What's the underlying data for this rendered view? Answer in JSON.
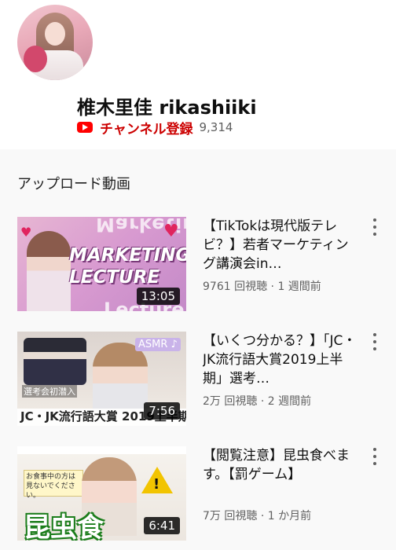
{
  "channel": {
    "name": "椎木里佳 rikashiiki",
    "subscribe_label": "チャンネル登録",
    "subscriber_count": "9,314"
  },
  "uploads": {
    "title": "アップロード動画",
    "videos": [
      {
        "title": "【TikTokは現代版テレビ？】若者マーケティング講演会in…",
        "views": "9761 回視聴",
        "age": "1 週間前",
        "duration": "13:05",
        "thumb_text": [
          "MARKETING",
          "LECTURE",
          "Marketing",
          "Lecture"
        ]
      },
      {
        "title": "【いくつ分かる？】「JC・JK流行語大賞2019上半期」選考…",
        "views": "2万 回視聴",
        "age": "2 週間前",
        "duration": "7:56",
        "thumb_text": [
          "JC・JK流行語大賞 2019上半期",
          "ASMR ♪",
          "選考会初潜入"
        ]
      },
      {
        "title": "【閲覧注意】昆虫食べます。【罰ゲーム】",
        "views": "7万 回視聴",
        "age": "1 か月前",
        "duration": "6:41",
        "thumb_text": [
          "昆虫食",
          "お食事中の方は見ないでください。",
          "!"
        ]
      }
    ]
  },
  "colors": {
    "brand_red": "#ff0000",
    "subscribe_text": "#cc0000",
    "meta_gray": "#606060"
  }
}
